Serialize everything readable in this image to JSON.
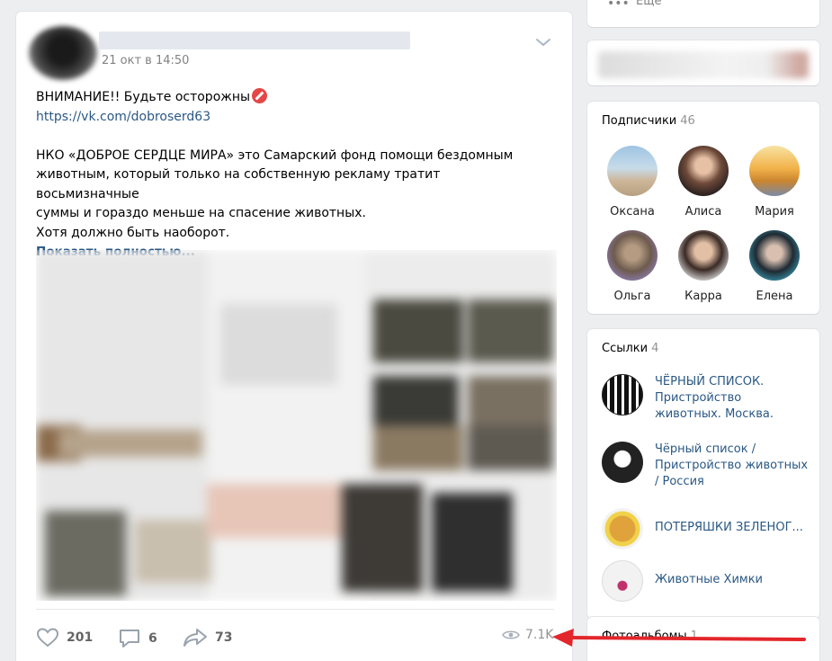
{
  "post": {
    "date": "21 окт в 14:50",
    "text_warning": "ВНИМАНИЕ!! Будьте осторожны",
    "link": "https://vk.com/dobroserd63",
    "paragraph_lines": [
      "НКО «ДОБРОЕ СЕРДЦЕ МИРА» это Самарский фонд помощи бездомным",
      "животным, который только на собственную рекламу тратит восьмизначные",
      "суммы и гораздо меньше на спасение животных.",
      "Хотя должно быть наоборот."
    ],
    "show_more": "Показать полностью...",
    "likes": "201",
    "comments": "6",
    "shares": "73",
    "views": "7.1K"
  },
  "sidebar": {
    "more_label": "Ещё",
    "subscribers": {
      "title": "Подписчики",
      "count": "46",
      "people": [
        {
          "name": "Оксана"
        },
        {
          "name": "Алиса"
        },
        {
          "name": "Мария"
        },
        {
          "name": "Ольга"
        },
        {
          "name": "Карра"
        },
        {
          "name": "Елена"
        }
      ]
    },
    "links": {
      "title": "Ссылки",
      "count": "4",
      "items": [
        {
          "label": "ЧЁРНЫЙ СПИСОК. Пристройство животных. Москва."
        },
        {
          "label": "Чёрный список / Пристройство животных / Россия"
        },
        {
          "label": "ПОТЕРЯШКИ ЗЕЛЕНОГ..."
        },
        {
          "label": "Животные Химки"
        }
      ]
    },
    "albums": {
      "title": "Фотоальбомы",
      "count": "1"
    }
  },
  "colors": {
    "link": "#2a5885",
    "background": "#edeef0",
    "arrow": "#e3262b"
  }
}
